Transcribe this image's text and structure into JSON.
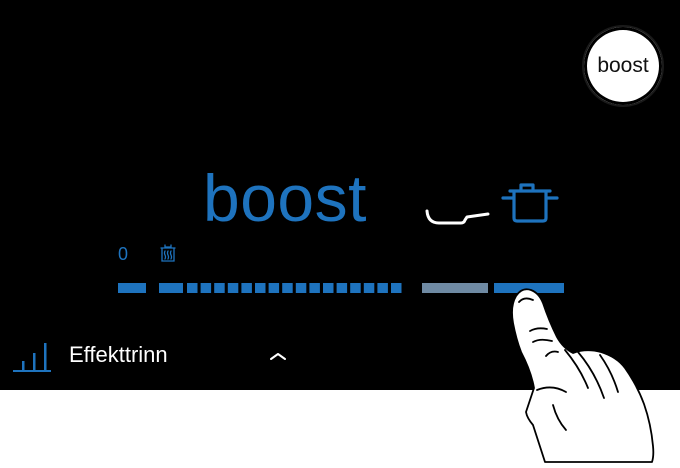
{
  "boost_button_label": "boost",
  "power_display": "boost",
  "slider": {
    "min_label": "0",
    "active_segment": "boost"
  },
  "footer": {
    "label": "Effekttrinn"
  },
  "colors": {
    "background": "#000000",
    "accent": "#1e73be",
    "boost_segment": "#6f8aa3",
    "text": "#ffffff"
  },
  "icons": {
    "pan": "frying-pan-icon",
    "pot": "cooking-pot-icon",
    "keep_warm": "keep-warm-icon",
    "power_levels": "power-level-icon",
    "chevron": "chevron-up-icon"
  }
}
